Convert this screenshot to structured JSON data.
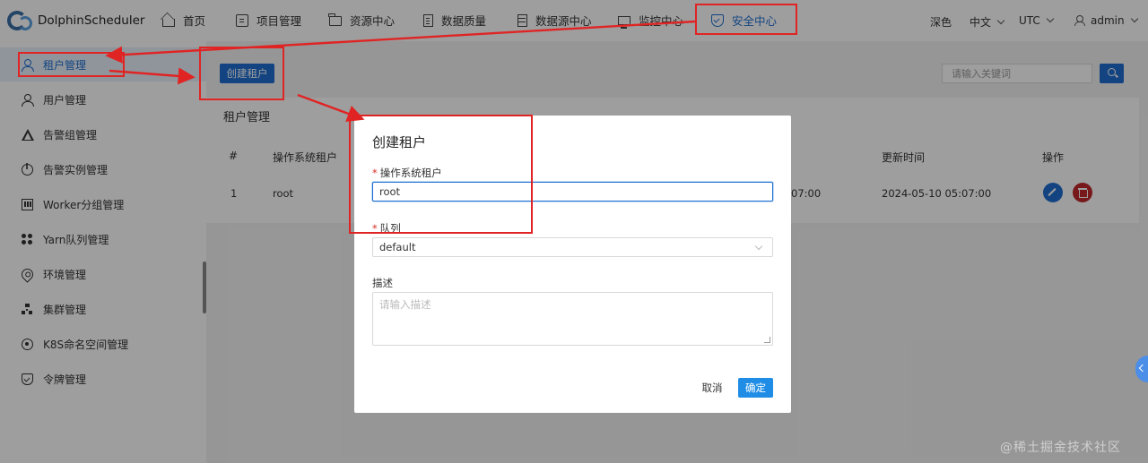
{
  "brand": {
    "name": "DolphinScheduler"
  },
  "nav": [
    {
      "label": "首页",
      "icon": "home-icon"
    },
    {
      "label": "项目管理",
      "icon": "project-icon"
    },
    {
      "label": "资源中心",
      "icon": "folder-icon"
    },
    {
      "label": "数据质量",
      "icon": "document-icon"
    },
    {
      "label": "数据源中心",
      "icon": "database-icon"
    },
    {
      "label": "监控中心",
      "icon": "monitor-icon"
    },
    {
      "label": "安全中心",
      "icon": "shield-icon",
      "active": true
    }
  ],
  "header_right": {
    "theme": "深色",
    "language": "中文",
    "timezone": "UTC",
    "user": "admin"
  },
  "sidebar": {
    "items": [
      {
        "label": "租户管理",
        "icon": "user-icon",
        "active": true
      },
      {
        "label": "用户管理",
        "icon": "user-icon"
      },
      {
        "label": "告警组管理",
        "icon": "warning-icon"
      },
      {
        "label": "告警实例管理",
        "icon": "info-icon"
      },
      {
        "label": "Worker分组管理",
        "icon": "worker-icon"
      },
      {
        "label": "Yarn队列管理",
        "icon": "yarn-icon"
      },
      {
        "label": "环境管理",
        "icon": "location-icon"
      },
      {
        "label": "集群管理",
        "icon": "cluster-icon"
      },
      {
        "label": "K8S命名空间管理",
        "icon": "k8s-icon"
      },
      {
        "label": "令牌管理",
        "icon": "token-icon"
      }
    ]
  },
  "toolbar": {
    "create_label": "创建租户",
    "search_placeholder": "请输入关键词"
  },
  "table": {
    "title": "租户管理",
    "headers": [
      "#",
      "操作系统租户",
      "更新时间",
      "操作"
    ],
    "rows": [
      {
        "index": "1",
        "tenant": "root",
        "create_time_fragment": "07:00",
        "update_time": "2024-05-10 05:07:00"
      }
    ]
  },
  "modal": {
    "title": "创建租户",
    "tenant_label": "操作系统租户",
    "tenant_value": "root",
    "queue_label": "队列",
    "queue_value": "default",
    "desc_label": "描述",
    "desc_placeholder": "请输入描述",
    "cancel_label": "取消",
    "ok_label": "确定"
  },
  "watermark": "@稀土掘金技术社区",
  "colors": {
    "accent": "#1f6fd1",
    "annotation": "#e02424",
    "danger": "#c1272d"
  }
}
